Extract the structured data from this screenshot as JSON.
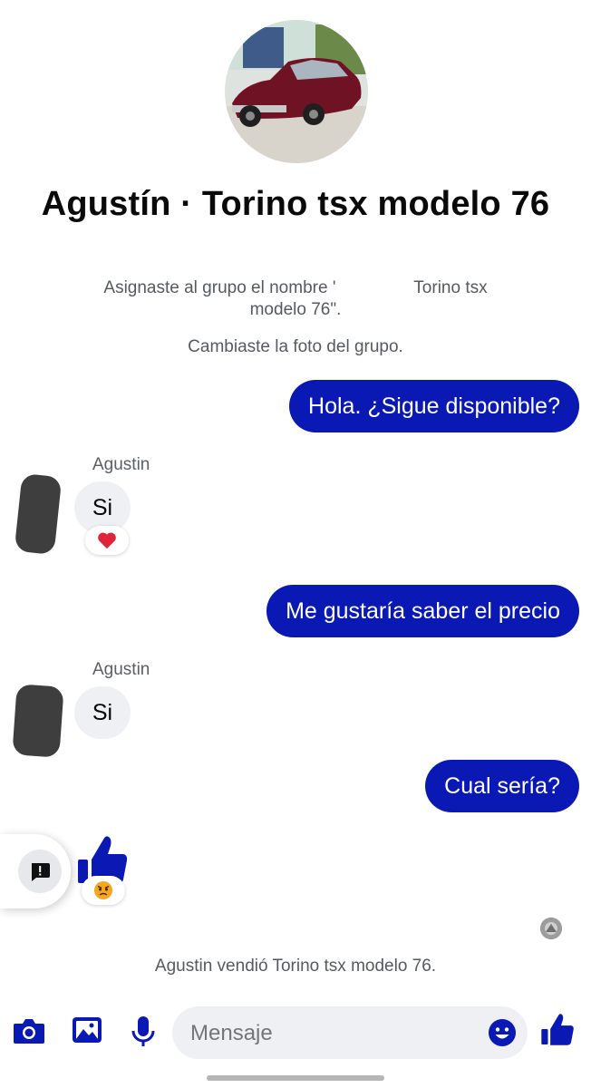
{
  "header": {
    "title": "Agustín · Torino tsx modelo 76"
  },
  "system_messages": {
    "rename_part1": "Asignaste al grupo el nombre '",
    "rename_part2": "Torino tsx",
    "rename_part3": "modelo 76\".",
    "photo_changed": "Cambiaste la foto del grupo.",
    "sold": "Agustin vendió Torino tsx modelo 76."
  },
  "messages": [
    {
      "from": "me",
      "text": "Hola. ¿Sigue disponible?"
    },
    {
      "from": "Agustin",
      "sender": "Agustin",
      "text": "Si",
      "reaction": "heart"
    },
    {
      "from": "me",
      "text": "Me gustaría saber el precio"
    },
    {
      "from": "Agustin",
      "sender": "Agustin",
      "text": "Si"
    },
    {
      "from": "me",
      "text": "Cual sería?"
    },
    {
      "from": "me",
      "type": "like-sticker",
      "reaction": "angry"
    }
  ],
  "composer": {
    "placeholder": "Mensaje"
  },
  "colors": {
    "accent": "#0a18b4",
    "incoming_bubble": "#eef0f3",
    "heart": "#e0243a",
    "angry": "#f5a623"
  },
  "icons": {
    "camera": "camera-icon",
    "gallery": "gallery-icon",
    "mic": "microphone-icon",
    "emoji": "emoji-icon",
    "like": "thumbs-up-icon",
    "report": "report-icon"
  }
}
